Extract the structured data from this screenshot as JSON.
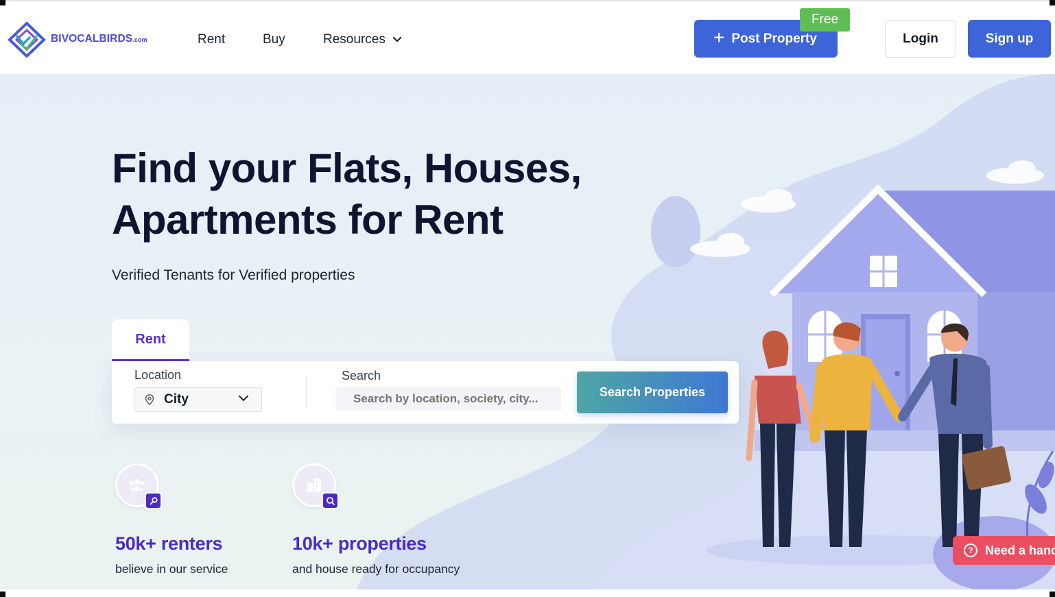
{
  "header": {
    "logo_text": "BIVOCALBIRDS",
    "logo_suffix": ".com",
    "nav": {
      "rent": "Rent",
      "buy": "Buy",
      "resources": "Resources"
    },
    "post_property_label": "Post Property",
    "free_badge": "Free",
    "login_label": "Login",
    "signup_label": "Sign up"
  },
  "hero": {
    "title_line1": "Find your Flats, Houses,",
    "title_line2": "Apartments for Rent",
    "subtitle": "Verified Tenants for  Verified properties"
  },
  "search": {
    "tab_rent": "Rent",
    "location_label": "Location",
    "city_value": "City",
    "search_label": "Search",
    "search_placeholder": "Search by location, society, city...",
    "search_button": "Search Properties"
  },
  "stats": [
    {
      "value": "50k+ renters",
      "desc": "believe in our service",
      "icon": "people-icon"
    },
    {
      "value": "10k+ properties",
      "desc": "and house ready for occupancy",
      "icon": "buildings-icon"
    }
  ],
  "help": {
    "label": "Need a hand"
  },
  "colors": {
    "primary": "#3d64d8",
    "accent": "#5b2fc9",
    "free": "#5fbd55",
    "help": "#ec4d61"
  }
}
